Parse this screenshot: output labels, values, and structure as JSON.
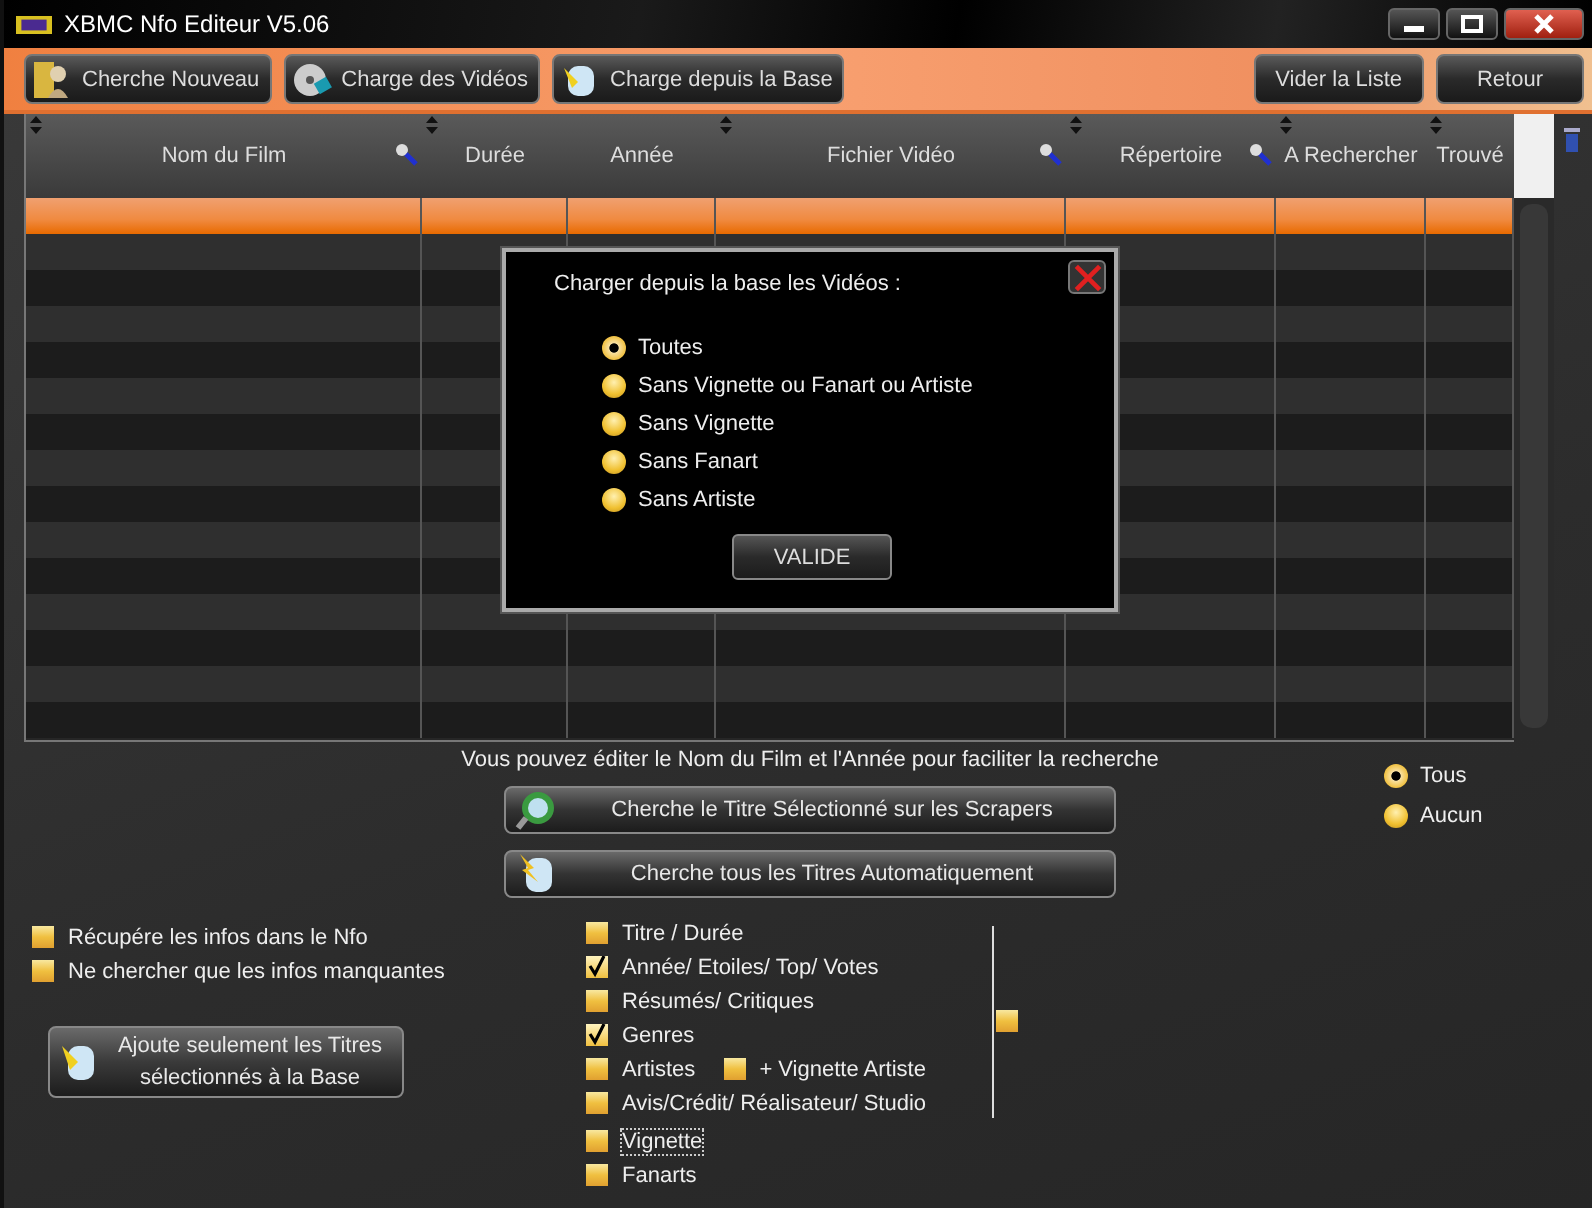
{
  "window": {
    "title": "XBMC Nfo Editeur V5.06"
  },
  "toolbar": {
    "left_buttons": [
      {
        "label": "Cherche Nouveau"
      },
      {
        "label": "Charge des Vidéos"
      },
      {
        "label": "Charge depuis la Base"
      }
    ],
    "right_buttons": [
      "Vider la Liste",
      "Retour"
    ]
  },
  "table": {
    "columns": [
      {
        "label": "Nom du Film",
        "sortable": true,
        "searchable": true
      },
      {
        "label": "Durée",
        "sortable": true,
        "searchable": false
      },
      {
        "label": "Année",
        "sortable": false,
        "searchable": false
      },
      {
        "label": "Fichier Vidéo",
        "sortable": true,
        "searchable": true
      },
      {
        "label": "Répertoire",
        "sortable": true,
        "searchable": true
      },
      {
        "label": "A Rechercher",
        "sortable": true,
        "searchable": false
      },
      {
        "label": "Trouvé",
        "sortable": true,
        "searchable": false
      }
    ],
    "rows": [
      {
        "selected": true
      },
      {
        "selected": false
      },
      {
        "selected": false
      },
      {
        "selected": false
      },
      {
        "selected": false
      },
      {
        "selected": false
      },
      {
        "selected": false
      },
      {
        "selected": false
      },
      {
        "selected": false
      },
      {
        "selected": false
      },
      {
        "selected": false
      },
      {
        "selected": false
      },
      {
        "selected": false
      },
      {
        "selected": false
      },
      {
        "selected": false
      }
    ]
  },
  "dialog": {
    "title": "Charger depuis la base les Vidéos :",
    "options": [
      {
        "label": "Toutes",
        "selected": true
      },
      {
        "label": "Sans Vignette ou Fanart ou Artiste",
        "selected": false
      },
      {
        "label": "Sans Vignette",
        "selected": false
      },
      {
        "label": "Sans Fanart",
        "selected": false
      },
      {
        "label": "Sans Artiste",
        "selected": false
      }
    ],
    "button": "VALIDE"
  },
  "hint": "Vous pouvez éditer le Nom du Film et l'Année pour faciliter la recherche",
  "search_buttons": [
    {
      "label": "Cherche le Titre Sélectionné sur les Scrapers"
    },
    {
      "label": "Cherche tous les Titres Automatiquement"
    }
  ],
  "select_all": [
    {
      "label": "Tous",
      "selected": true
    },
    {
      "label": "Aucun",
      "selected": false
    }
  ],
  "left_options": [
    {
      "label": "Récupére les infos dans le Nfo",
      "checked": false
    },
    {
      "label": "Ne chercher que les infos manquantes",
      "checked": false
    }
  ],
  "add_button": "Ajoute seulement les Titres sélectionnés à la Base",
  "fields": [
    {
      "label": "Titre / Durée",
      "checked": false,
      "focused": false
    },
    {
      "label": "Année/ Etoiles/ Top/ Votes",
      "checked": true,
      "focused": false
    },
    {
      "label": "Résumés/ Critiques",
      "checked": false,
      "focused": false
    },
    {
      "label": "Genres",
      "checked": true,
      "focused": false
    },
    {
      "label": "Artistes",
      "checked": false,
      "focused": false,
      "extra": {
        "label": "+ Vignette Artiste",
        "checked": false
      }
    },
    {
      "label": "Avis/Crédit/ Réalisateur/ Studio",
      "checked": false,
      "focused": false
    },
    {
      "label": "Vignette",
      "checked": false,
      "focused": true
    },
    {
      "label": "Fanarts",
      "checked": false,
      "focused": false
    }
  ],
  "group_checkbox": {
    "checked": false
  }
}
